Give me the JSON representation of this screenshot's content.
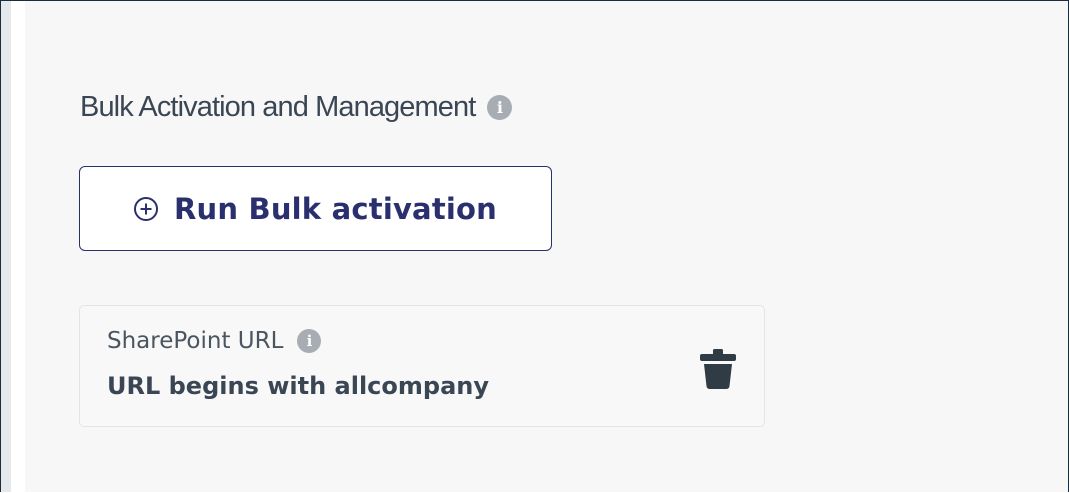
{
  "section": {
    "title": "Bulk Activation and Management",
    "info_icon": "info-circle-icon"
  },
  "actions": {
    "run_bulk_label": "Run Bulk activation",
    "run_bulk_icon": "plus-circle-icon"
  },
  "rule": {
    "field_label": "SharePoint URL",
    "field_info_icon": "info-circle-icon",
    "condition": "URL begins with allcompany",
    "delete_icon": "trash-icon"
  },
  "colors": {
    "button_accent": "#2a2f6e",
    "title_text": "#3a4653",
    "panel_background": "#f7f7f7",
    "info_icon": "#a8adb3",
    "trash_icon": "#2f3b45"
  }
}
